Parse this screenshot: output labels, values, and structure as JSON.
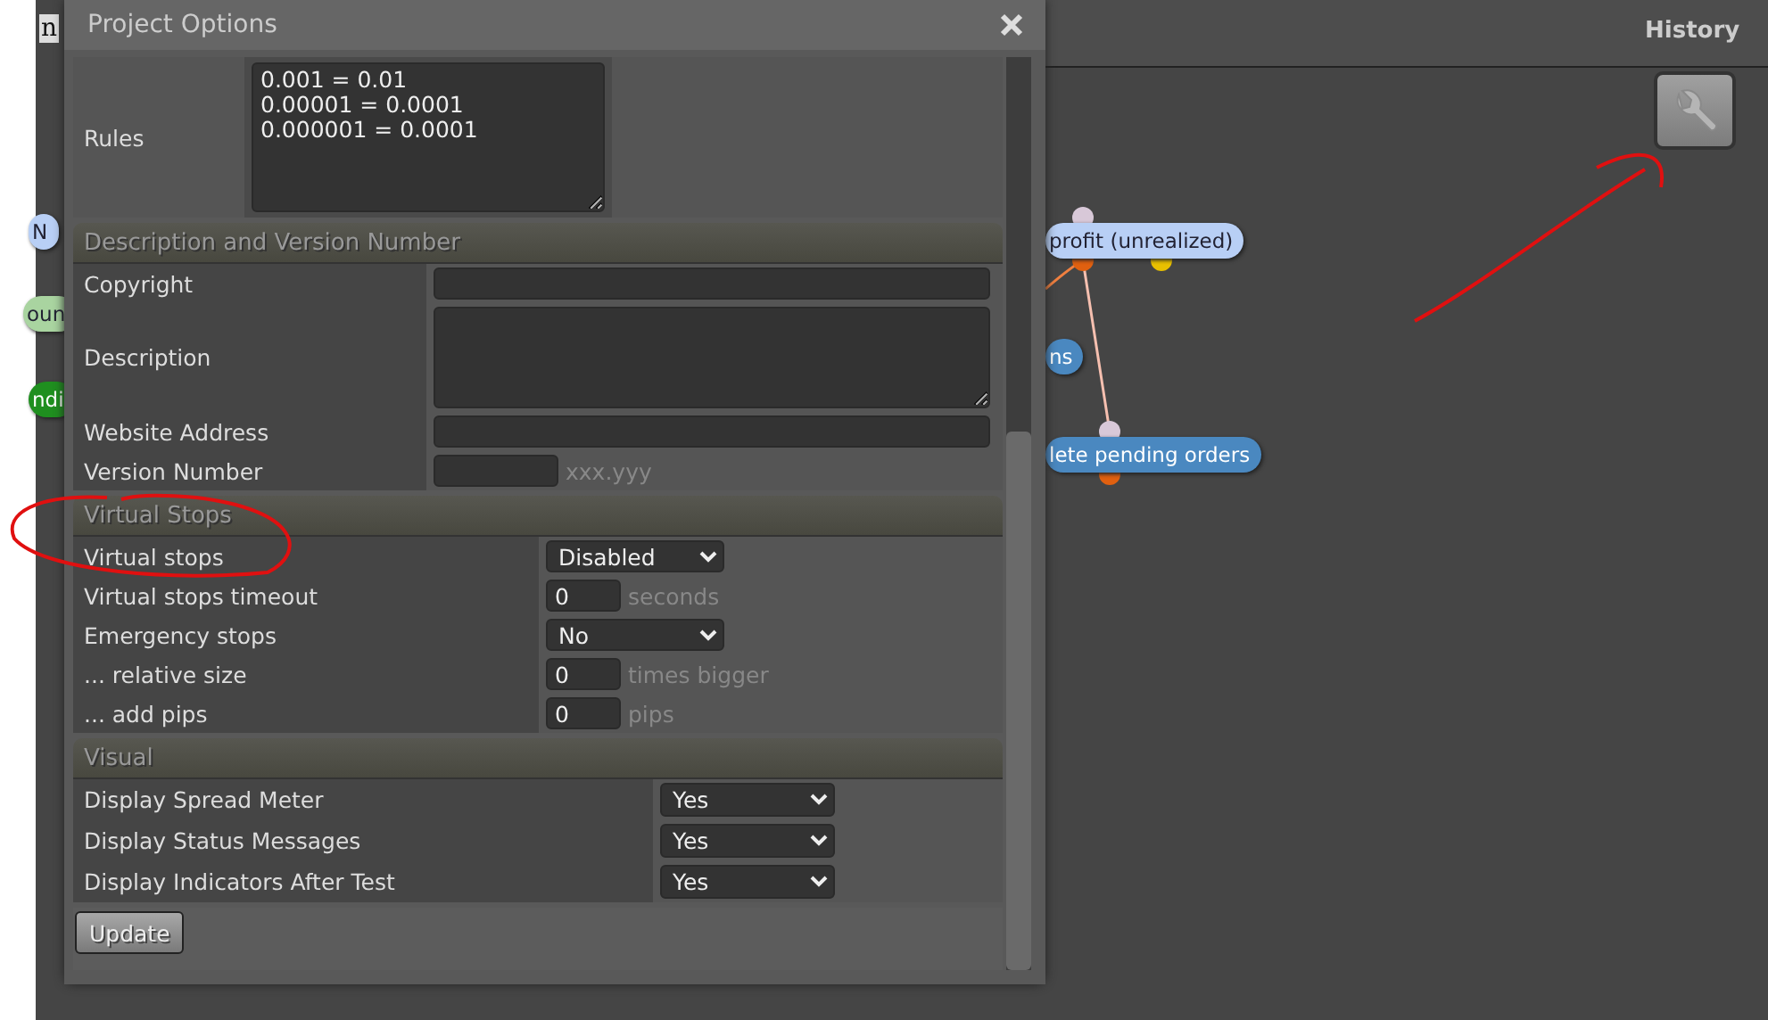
{
  "app": {
    "header_fragment": "n",
    "history_label": "History"
  },
  "canvas": {
    "nodes": [
      {
        "label": "N",
        "color": "#b8cff5",
        "dark": false
      },
      {
        "label": "oun",
        "color": "#a9d4a0",
        "dark": false
      },
      {
        "label": "ndi",
        "color": "#1f8f1f",
        "dark": true
      },
      {
        "label": "profit (unrealized)",
        "color": "#b8cff5",
        "dark": false
      },
      {
        "label": "ns",
        "color": "#4a88c0",
        "dark": true
      },
      {
        "label": "lete pending orders",
        "color": "#4a88c0",
        "dark": true
      }
    ]
  },
  "dialog": {
    "title": "Project Options",
    "rules": {
      "label": "Rules",
      "value": "0.001 = 0.01\n0.00001 = 0.0001\n0.000001 = 0.0001"
    },
    "sections": [
      {
        "title": "Description and Version Number",
        "rows": [
          {
            "label": "Copyright",
            "kind": "text"
          },
          {
            "label": "Description",
            "kind": "textarea"
          },
          {
            "label": "Website Address",
            "kind": "text"
          },
          {
            "label": "Version Number",
            "kind": "short",
            "suffix": "xxx.yyy"
          }
        ]
      },
      {
        "title": "Virtual Stops",
        "rows": [
          {
            "label": "Virtual stops",
            "kind": "select",
            "value": "Disabled"
          },
          {
            "label": "Virtual stops timeout",
            "kind": "number",
            "value": "0",
            "suffix": "seconds"
          },
          {
            "label": "Emergency stops",
            "kind": "select",
            "value": "No"
          },
          {
            "label": "... relative size",
            "kind": "number",
            "value": "0",
            "suffix": "times bigger"
          },
          {
            "label": "... add pips",
            "kind": "number",
            "value": "0",
            "suffix": "pips"
          }
        ]
      },
      {
        "title": "Visual",
        "rows": [
          {
            "label": "Display Spread Meter",
            "kind": "select",
            "value": "Yes"
          },
          {
            "label": "Display Status Messages",
            "kind": "select",
            "value": "Yes"
          },
          {
            "label": "Display Indicators After Test",
            "kind": "select",
            "value": "Yes"
          }
        ]
      }
    ],
    "update_button": "Update"
  }
}
